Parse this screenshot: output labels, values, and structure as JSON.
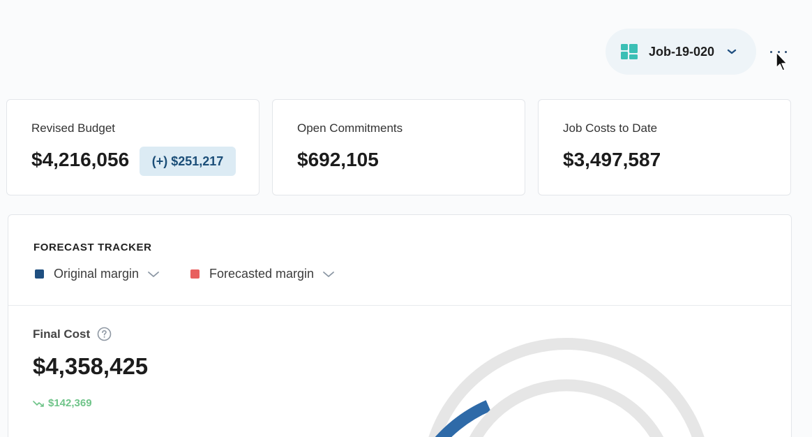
{
  "header": {
    "job_selector": {
      "label": "Job-19-020",
      "icon": "grid-icon"
    },
    "more_menu": {
      "icon": "more-icon"
    }
  },
  "stats": [
    {
      "label": "Revised Budget",
      "value": "$4,216,056",
      "badge": "(+) $251,217"
    },
    {
      "label": "Open Commitments",
      "value": "$692,105"
    },
    {
      "label": "Job Costs to Date",
      "value": "$3,497,587"
    }
  ],
  "tracker": {
    "title": "FORECAST TRACKER",
    "legend": [
      {
        "label": "Original margin",
        "color": "#1f4f80"
      },
      {
        "label": "Forecasted margin",
        "color": "#e8605f"
      }
    ],
    "final_cost": {
      "label": "Final Cost",
      "value": "$4,358,425",
      "delta": "$142,369",
      "delta_color": "#6fc489"
    },
    "gauge_colors": {
      "track": "#e6e6e6",
      "fill": "#2e6aa8"
    }
  }
}
